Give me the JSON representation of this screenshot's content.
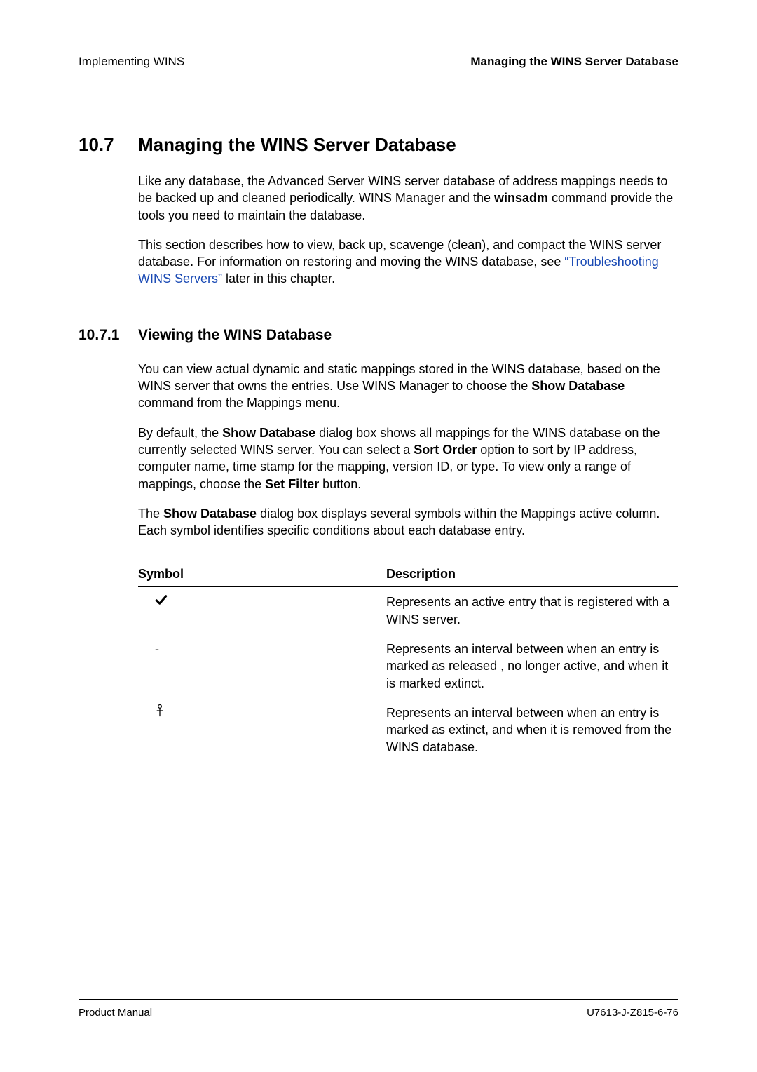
{
  "header": {
    "left": "Implementing WINS",
    "right": "Managing the WINS Server Database"
  },
  "section": {
    "number": "10.7",
    "title": "Managing the WINS Server Database",
    "p1_a": "Like any database, the Advanced Server WINS server database of address mappings needs to be backed up and cleaned periodically. WINS Manager and the ",
    "p1_bold": "winsadm",
    "p1_b": " command provide the tools you need to maintain the database.",
    "p2_a": "This section describes how to view, back up, scavenge (clean), and compact the WINS server database. For information on restoring and moving the WINS database, see ",
    "p2_link": "“Troubleshooting WINS Servers”",
    "p2_b": " later in this chapter."
  },
  "subsection": {
    "number": "10.7.1",
    "title": "Viewing the WINS Database",
    "p1_a": "You can view actual dynamic and static mappings stored in the WINS database, based on the WINS server that owns the entries. Use WINS Manager to choose the ",
    "p1_bold": "Show Database",
    "p1_b": " command from the Mappings menu.",
    "p2_a": "By default, the ",
    "p2_bold1": "Show Database",
    "p2_b": " dialog box shows all mappings for the WINS database on the currently selected WINS server. You can select a ",
    "p2_bold2": "Sort Order",
    "p2_c": " option to sort by IP address, computer name, time stamp for the mapping, version ID, or type. To view only a range of mappings, choose the ",
    "p2_bold3": "Set Filter",
    "p2_d": " button.",
    "p3_a": "The ",
    "p3_bold": "Show Database",
    "p3_b": " dialog box displays several symbols within the Mappings active column. Each symbol identifies specific conditions about each database entry."
  },
  "table": {
    "head_symbol": "Symbol",
    "head_desc": "Description",
    "rows": [
      {
        "symbol_name": "checkmark-icon",
        "desc": "Represents an active entry that is registered with a WINS server."
      },
      {
        "symbol_name": "dash-icon",
        "desc": "Represents an interval between when an entry is marked as released , no longer active, and when it is marked extinct."
      },
      {
        "symbol_name": "tombstone-icon",
        "desc": "Represents an interval between when an entry is marked as extinct, and when it is removed from the WINS database."
      }
    ]
  },
  "footer": {
    "left": "Product Manual",
    "right": "U7613-J-Z815-6-76"
  }
}
